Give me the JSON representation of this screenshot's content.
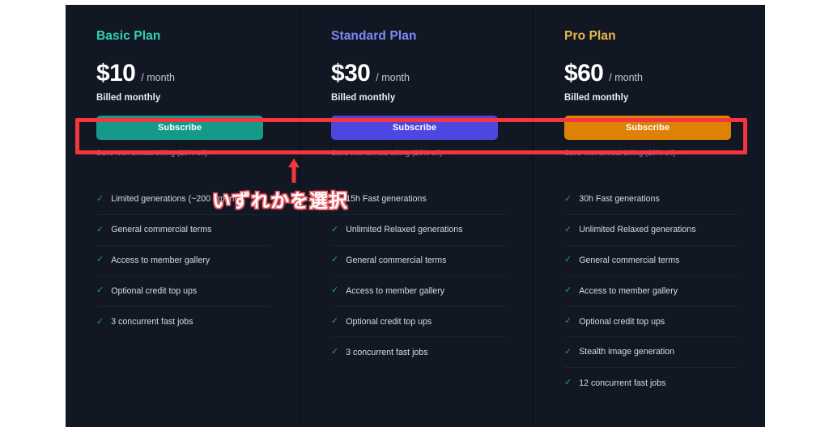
{
  "panel": {
    "background_color": "#121724"
  },
  "annotations": {
    "highlight_box_color": "#f5353f",
    "arrow_color": "#f5353f",
    "arrow_icon": "arrow-up-icon",
    "callout_text": "いずれかを選択"
  },
  "plans": [
    {
      "name": "Basic Plan",
      "name_color": "#2dd4b0",
      "price": "$10",
      "period": "/ month",
      "billing_note": "Billed monthly",
      "subscribe_label": "Subscribe",
      "subscribe_color": "#159a8a",
      "annual_link": "Save with annual billing (20% off) →",
      "features": [
        "Limited generations (~200 / month)",
        "General commercial terms",
        "Access to member gallery",
        "Optional credit top ups",
        "3 concurrent fast jobs"
      ]
    },
    {
      "name": "Standard Plan",
      "name_color": "#7b8cf5",
      "price": "$30",
      "period": "/ month",
      "billing_note": "Billed monthly",
      "subscribe_label": "Subscribe",
      "subscribe_color": "#4d46e0",
      "annual_link": "Save with annual billing (20% off) →",
      "features": [
        "15h Fast generations",
        "Unlimited Relaxed generations",
        "General commercial terms",
        "Access to member gallery",
        "Optional credit top ups",
        "3 concurrent fast jobs"
      ]
    },
    {
      "name": "Pro Plan",
      "name_color": "#e9b949",
      "price": "$60",
      "period": "/ month",
      "billing_note": "Billed monthly",
      "subscribe_label": "Subscribe",
      "subscribe_color": "#dd8204",
      "annual_link": "Save with annual billing (20% off) →",
      "features": [
        "30h Fast generations",
        "Unlimited Relaxed generations",
        "General commercial terms",
        "Access to member gallery",
        "Optional credit top ups",
        "Stealth image generation",
        "12 concurrent fast jobs"
      ]
    }
  ],
  "icons": {
    "check": "✓"
  }
}
